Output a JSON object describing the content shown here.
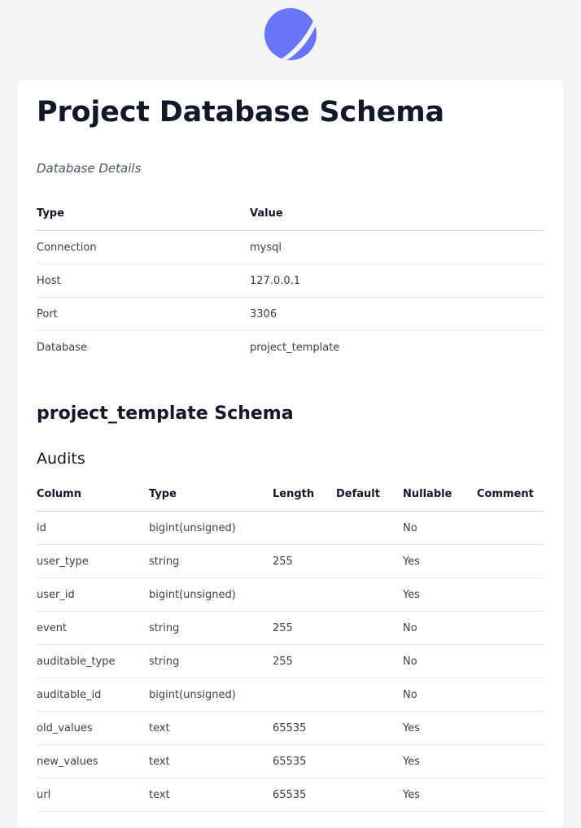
{
  "brand": {
    "logo": "planet-logo-icon",
    "accent": "#6875f5"
  },
  "page": {
    "title": "Project Database Schema",
    "subtitle": "Database Details"
  },
  "details": {
    "headers": [
      "Type",
      "Value"
    ],
    "rows": [
      [
        "Connection",
        "mysql"
      ],
      [
        "Host",
        "127.0.0.1"
      ],
      [
        "Port",
        "3306"
      ],
      [
        "Database",
        "project_template"
      ]
    ]
  },
  "schema": {
    "title": "project_template Schema",
    "tables": [
      {
        "name": "Audits",
        "headers": [
          "Column",
          "Type",
          "Length",
          "Default",
          "Nullable",
          "Comment"
        ],
        "rows": [
          [
            "id",
            "bigint(unsigned)",
            "",
            "",
            "No",
            ""
          ],
          [
            "user_type",
            "string",
            "255",
            "",
            "Yes",
            ""
          ],
          [
            "user_id",
            "bigint(unsigned)",
            "",
            "",
            "Yes",
            ""
          ],
          [
            "event",
            "string",
            "255",
            "",
            "No",
            ""
          ],
          [
            "auditable_type",
            "string",
            "255",
            "",
            "No",
            ""
          ],
          [
            "auditable_id",
            "bigint(unsigned)",
            "",
            "",
            "No",
            ""
          ],
          [
            "old_values",
            "text",
            "65535",
            "",
            "Yes",
            ""
          ],
          [
            "new_values",
            "text",
            "65535",
            "",
            "Yes",
            ""
          ],
          [
            "url",
            "text",
            "65535",
            "",
            "Yes",
            ""
          ]
        ]
      }
    ]
  }
}
